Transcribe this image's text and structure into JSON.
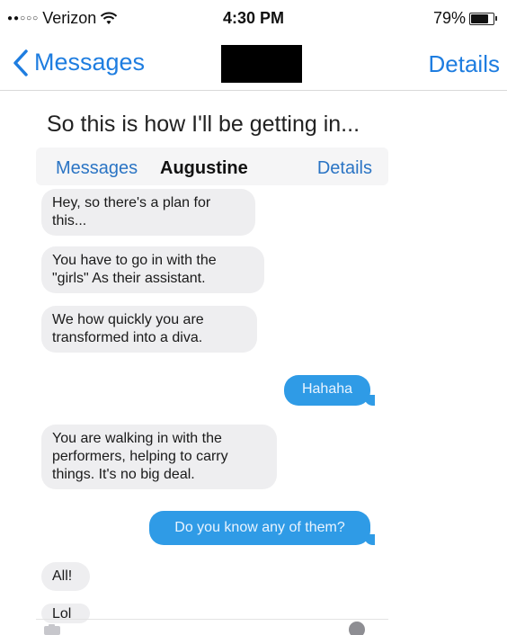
{
  "status_bar": {
    "signal_dots": "●●○○○",
    "carrier": "Verizon",
    "wifi_icon": "wifi-icon",
    "time": "4:30 PM",
    "battery_percent": "79%",
    "battery_level": 0.79
  },
  "nav": {
    "back_label": "Messages",
    "details_label": "Details",
    "title_redacted": true
  },
  "caption": "So this is how I'll be getting in...",
  "inner": {
    "nav": {
      "back_label": "Messages",
      "title": "Augustine",
      "details_label": "Details"
    },
    "messages": [
      {
        "from": "them",
        "text": "Hey, so there's a plan for this..."
      },
      {
        "from": "them",
        "text": "You have to go in with the \"girls\" As their assistant."
      },
      {
        "from": "them",
        "text": "We how quickly you are transformed into a diva."
      },
      {
        "from": "me",
        "text": "Hahaha"
      },
      {
        "from": "them",
        "text": "You are walking in with the performers, helping to carry things. It's no big deal."
      },
      {
        "from": "me",
        "text": "Do you know any of them?"
      },
      {
        "from": "them",
        "text": "All!"
      },
      {
        "from": "them",
        "text": "Lol"
      }
    ]
  },
  "colors": {
    "ios_blue": "#1e7de0",
    "bubble_blue": "#2f9be6",
    "bubble_gray": "#eeeef0"
  }
}
